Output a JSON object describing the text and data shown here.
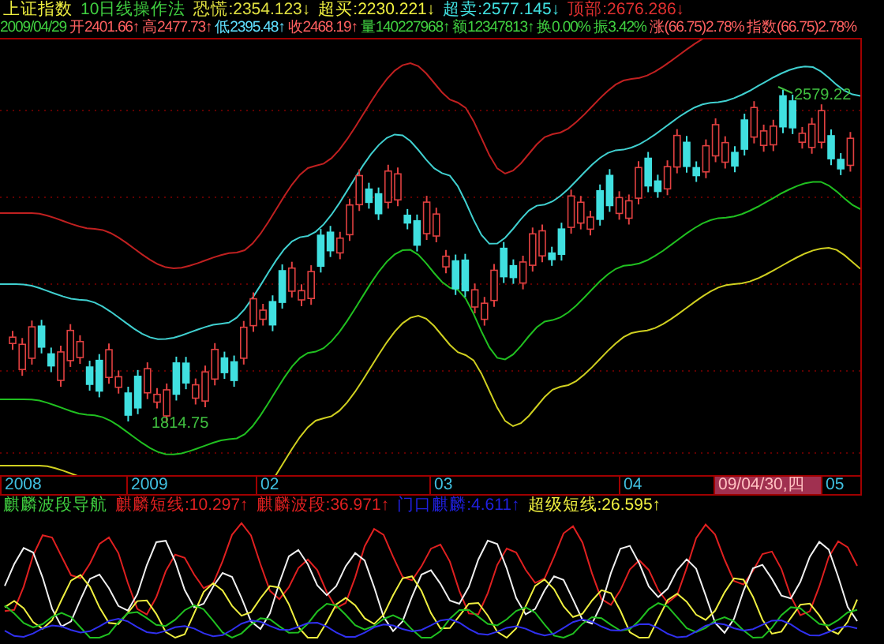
{
  "header": {
    "symbol": "上证指数",
    "indicator": "10日线操作法",
    "signals": [
      {
        "text": "恐慌:2354.123↓",
        "color": "#e0e040"
      },
      {
        "text": "超买:2230.221↓",
        "color": "#f0f040"
      },
      {
        "text": "超卖:2577.145↓",
        "color": "#40e0e0"
      },
      {
        "text": "顶部:2676.286↓",
        "color": "#e03030"
      }
    ]
  },
  "quote": {
    "date": "2009/04/29",
    "fields": [
      {
        "label": "开",
        "value": "2401.66",
        "arrow": "↑",
        "color": "#ff6060"
      },
      {
        "label": "高",
        "value": "2477.73",
        "arrow": "↑",
        "color": "#ff6060"
      },
      {
        "label": "低",
        "value": "2395.48",
        "arrow": "↑",
        "color": "#60e0ff"
      },
      {
        "label": "收",
        "value": "2468.19",
        "arrow": "↑",
        "color": "#ff6060"
      },
      {
        "label": "量",
        "value": "140227968",
        "arrow": "↑",
        "color": "#40d040"
      },
      {
        "label": "额",
        "value": "12347813",
        "arrow": "↑",
        "color": "#40d040"
      },
      {
        "label": "换",
        "value": "0.00%",
        "color": "#40d040"
      },
      {
        "label": "振",
        "value": "3.42%",
        "color": "#40d040"
      },
      {
        "label": "涨",
        "value": "(66.75)2.78%",
        "color": "#ff6060"
      },
      {
        "label": "指数",
        "value": "(66.75)2.78%",
        "color": "#ff6060"
      }
    ]
  },
  "chart": {
    "high_label": "2579.22",
    "low_label": "1814.75"
  },
  "x_axis": [
    {
      "label": "2008",
      "selected": false
    },
    {
      "label": "2009",
      "selected": false
    },
    {
      "label": "02",
      "selected": false
    },
    {
      "label": "03",
      "selected": false
    },
    {
      "label": "04",
      "selected": false
    },
    {
      "label": "09/04/30,四",
      "selected": true
    },
    {
      "label": "05",
      "selected": false
    }
  ],
  "indicator_legend": {
    "title": "麒麟波段导航",
    "lines": [
      {
        "text": "麒麟短线:10.297↑",
        "color": "#e02020"
      },
      {
        "text": "麒麟波段:36.971↑",
        "color": "#e02020"
      },
      {
        "text": "门口麒麟:4.611↑",
        "color": "#2020e0"
      },
      {
        "text": "超级短线:26.595↑",
        "color": "#f0f040"
      }
    ]
  }
}
